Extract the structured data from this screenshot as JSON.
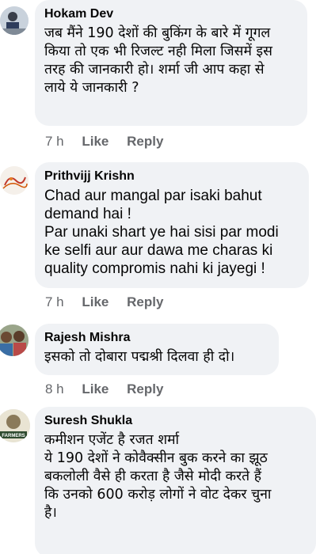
{
  "comments": [
    {
      "author": "Hokam Dev",
      "text": "जब मैंने 190 देशों की बुकिंग के बारे में गूगल\nकिया तो एक भी रिजल्ट नही मिला जिसमें इस\nतरह की जानकारी हो। शर्मा जी आप कहा से\nलाये ये जानकारी ?",
      "time": "7 h",
      "like": "Like",
      "reply": "Reply"
    },
    {
      "author": "Prithvijj Krishn",
      "text": "Chad aur mangal par isaki bahut\ndemand hai !\nPar unaki shart ye hai sisi par modi\nke selfi aur aur dawa me charas ki\nquality compromis nahi ki jayegi !",
      "time": "7 h",
      "like": "Like",
      "reply": "Reply"
    },
    {
      "author": "Rajesh Mishra",
      "text": "इसको तो दोबारा पद्मश्री दिलवा ही दो।",
      "time": "8 h",
      "like": "Like",
      "reply": "Reply"
    },
    {
      "author": "Suresh Shukla",
      "text": "कमीशन एजेंट है रजत शर्मा\nये 190 देशों ने कोवैक्सीन बुक करने का झूठ\nबकलोली वैसे ही करता है जैसे मोदी करते हैं\nकि उनको 600 करोड़ लोगों ने वोट देकर चुना\nहै।",
      "avatar_text": "FARMERS",
      "time": "",
      "like": "",
      "reply": ""
    }
  ]
}
